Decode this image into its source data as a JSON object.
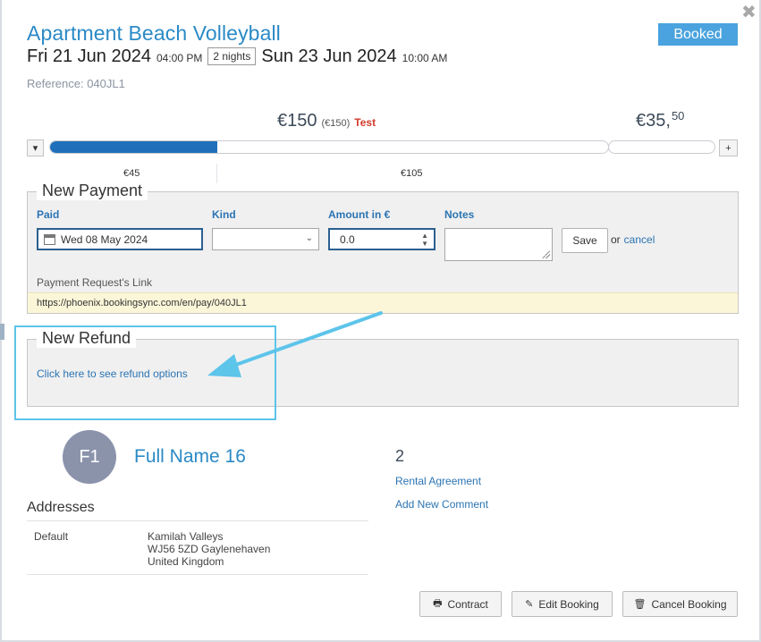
{
  "booking": {
    "title": "Apartment Beach Volleyball",
    "status": "Booked",
    "checkin_date": "Fri 21 Jun 2024",
    "checkin_time": "04:00 PM",
    "nights": "2 nights",
    "checkout_date": "Sun 23 Jun 2024",
    "checkout_time": "10:00 AM",
    "reference": "Reference: 040JL1"
  },
  "amounts": {
    "total": "€150",
    "total_paren": "(€150)",
    "test_label": "Test",
    "balance_main": "€35,",
    "balance_cents": "50",
    "progress_paid_fraction": 0.3,
    "paid_label": "€45",
    "remaining_label": "€105",
    "collapse_label": "▾",
    "expand_label": "+"
  },
  "new_payment": {
    "legend": "New Payment",
    "paid_label": "Paid",
    "paid_value": "Wed 08 May 2024",
    "kind_label": "Kind",
    "kind_value": "",
    "amount_label": "Amount in €",
    "amount_value": "0.0",
    "notes_label": "Notes",
    "notes_value": "",
    "save_label": "Save",
    "or_label": "or",
    "cancel_label": "cancel",
    "link_label": "Payment Request's Link",
    "link_url": "https://phoenix.bookingsync.com/en/pay/040JL1"
  },
  "new_refund": {
    "legend": "New Refund",
    "link_text": "Click here to see refund options"
  },
  "guest": {
    "initials": "F1",
    "name": "Full Name 16",
    "count": "2",
    "rental_agreement": "Rental Agreement",
    "add_comment": "Add New Comment"
  },
  "addresses": {
    "title": "Addresses",
    "type": "Default",
    "line1": "Kamilah Valleys",
    "line2": "WJ56 5ZD Gaylenehaven",
    "line3": "United Kingdom"
  },
  "footer": {
    "contract": "Contract",
    "edit": "Edit Booking",
    "cancel": "Cancel Booking"
  },
  "colors": {
    "accent": "#2b8ac6",
    "badge": "#4aa3de",
    "progress": "#1f6fba",
    "highlight": "#5dc4ea",
    "test": "#d23b2b"
  },
  "icons": {
    "close": "close-icon",
    "calendar": "calendar-icon",
    "print": "printer-icon",
    "edit": "pencil-icon",
    "trash": "trash-icon",
    "arrow": "annotation-arrow-icon"
  }
}
